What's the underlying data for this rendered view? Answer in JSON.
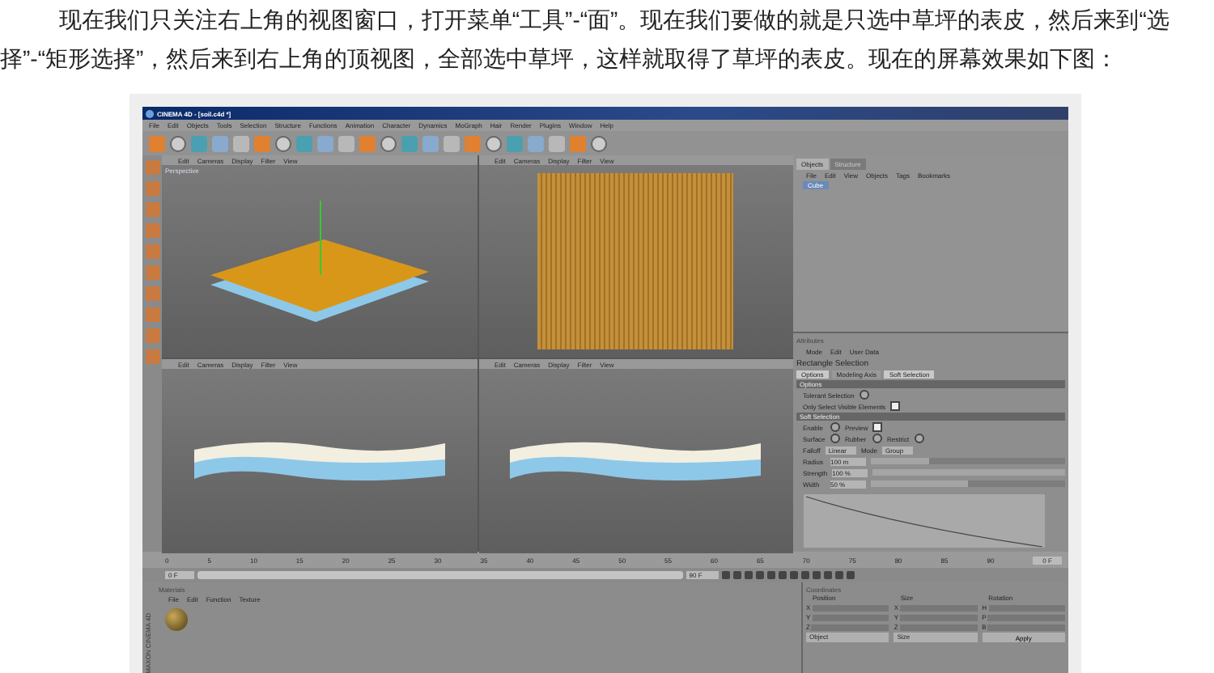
{
  "paragraph": "现在我们只关注右上角的视图窗口，打开菜单“工具”-“面”。现在我们要做的就是只选中草坪的表皮，然后来到“选择”-“矩形选择”，然后来到右上角的顶视图，全部选中草坪，这样就取得了草坪的表皮。现在的屏幕效果如下图：",
  "app": {
    "title": "CINEMA 4D - [soil.c4d *]",
    "menu": [
      "File",
      "Edit",
      "Objects",
      "Tools",
      "Selection",
      "Structure",
      "Functions",
      "Animation",
      "Character",
      "Dynamics",
      "MoGraph",
      "Hair",
      "Render",
      "Plugins",
      "Window",
      "Help"
    ],
    "viewports": [
      {
        "menu": [
          "Edit",
          "Cameras",
          "Display",
          "Filter",
          "View"
        ],
        "label": "Perspective",
        "kind": "perspective"
      },
      {
        "menu": [
          "Edit",
          "Cameras",
          "Display",
          "Filter",
          "View"
        ],
        "kind": "top"
      },
      {
        "menu": [
          "Edit",
          "Cameras",
          "Display",
          "Filter",
          "View"
        ],
        "kind": "side"
      },
      {
        "menu": [
          "Edit",
          "Cameras",
          "Display",
          "Filter",
          "View"
        ],
        "kind": "side"
      }
    ],
    "object_manager": {
      "tabs": [
        {
          "label": "Objects",
          "selected": true
        },
        {
          "label": "Structure",
          "selected": false
        }
      ],
      "menu": [
        "File",
        "Edit",
        "View",
        "Objects",
        "Tags",
        "Bookmarks"
      ],
      "objects": [
        "Cube"
      ]
    },
    "attributes": {
      "title": "Attributes",
      "menu": [
        "Mode",
        "Edit",
        "User Data"
      ],
      "tool": "Rectangle Selection",
      "tabs": [
        {
          "label": "Options",
          "selected": true
        },
        {
          "label": "Modeling Axis",
          "selected": false
        },
        {
          "label": "Soft Selection",
          "selected": true
        }
      ],
      "sections": [
        {
          "title": "Options",
          "rows": [
            {
              "kind": "check",
              "label": "Tolerant Selection",
              "checked": false
            },
            {
              "kind": "check",
              "label": "Only Select Visible Elements",
              "checked": true
            }
          ]
        },
        {
          "title": "Soft Selection",
          "rows": [
            {
              "kind": "checks",
              "items": [
                {
                  "label": "Enable",
                  "checked": false
                },
                {
                  "label": "Preview",
                  "checked": true
                }
              ]
            },
            {
              "kind": "checks",
              "items": [
                {
                  "label": "Surface",
                  "checked": false
                },
                {
                  "label": "Rubber",
                  "checked": false
                },
                {
                  "label": "Restrict",
                  "checked": false
                }
              ]
            },
            {
              "kind": "selects",
              "items": [
                {
                  "label": "Falloff",
                  "value": "Linear"
                },
                {
                  "label": "Mode",
                  "value": "Group"
                }
              ]
            },
            {
              "kind": "slider",
              "label": "Radius",
              "value": "100 m",
              "level": 0.3
            },
            {
              "kind": "slider",
              "label": "Strength",
              "value": "100 %",
              "level": 1
            },
            {
              "kind": "slider",
              "label": "Width",
              "value": "50 %",
              "level": 0.5
            }
          ]
        }
      ]
    },
    "timeline": {
      "ticks": [
        "0",
        "5",
        "10",
        "15",
        "20",
        "25",
        "30",
        "35",
        "40",
        "45",
        "50",
        "55",
        "60",
        "65",
        "70",
        "75",
        "80",
        "85",
        "90"
      ],
      "end": "0 F",
      "range": {
        "level": 1
      },
      "start_field": "0 F",
      "end_field": "90 F"
    },
    "materials": {
      "title": "Materials",
      "menu": [
        "File",
        "Edit",
        "Function",
        "Texture"
      ]
    },
    "coordinates": {
      "title": "Coordinates",
      "columns": [
        "Position",
        "Size",
        "Rotation"
      ],
      "axes": [
        [
          "X",
          "X",
          "H"
        ],
        [
          "Y",
          "Y",
          "P"
        ],
        [
          "Z",
          "Z",
          "B"
        ]
      ],
      "selects": [
        "Object",
        "Size"
      ],
      "button": "Apply"
    },
    "brand": "MAXON CINEMA 4D"
  }
}
